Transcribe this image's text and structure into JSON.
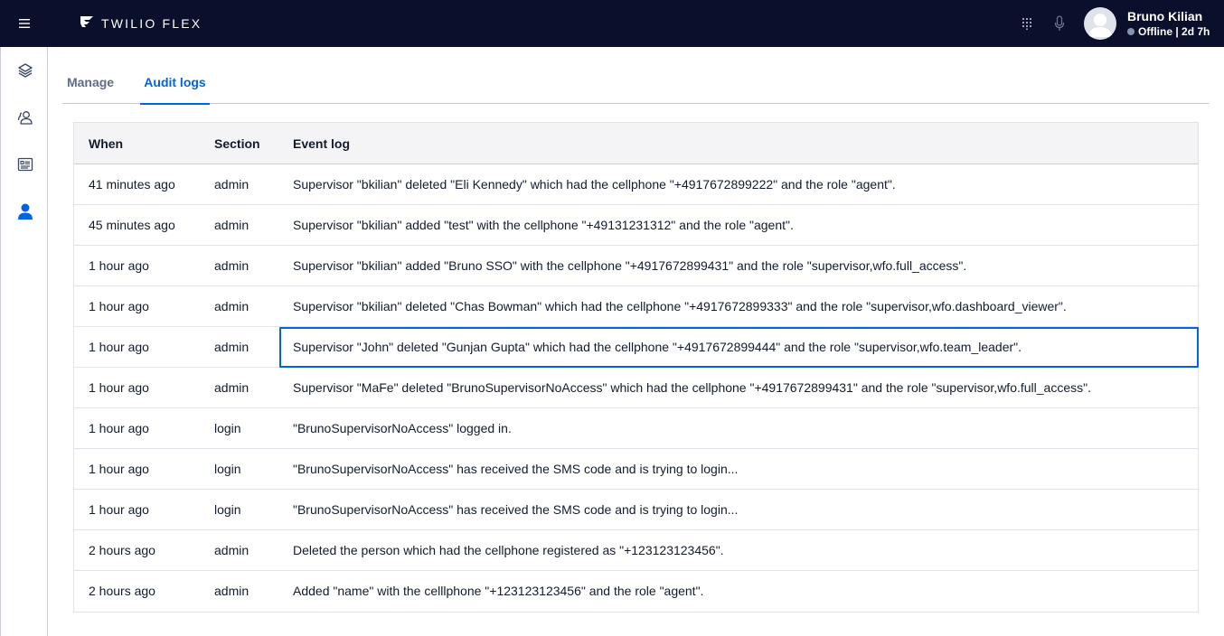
{
  "header": {
    "brand": "TWILIO FLEX",
    "user_name": "Bruno Kilian",
    "user_status": "Offline | 2d 7h"
  },
  "colors": {
    "topbar": "#0a0f2c",
    "accent": "#0263e0",
    "status_offline": "#8891aa"
  },
  "icons": {
    "menu": "hamburger-icon",
    "logo": "twilio-flex-logo",
    "dialpad": "dialpad-icon",
    "mic": "microphone-icon",
    "nav": [
      "layers-icon",
      "teams-icon",
      "contact-card-icon",
      "admin-user-icon"
    ]
  },
  "tabs": [
    {
      "label": "Manage",
      "active": false
    },
    {
      "label": "Audit logs",
      "active": true
    }
  ],
  "table": {
    "columns": [
      "When",
      "Section",
      "Event log"
    ],
    "rows": [
      {
        "when": "41 minutes ago",
        "section": "admin",
        "event": "Supervisor \"bkilian\" deleted \"Eli Kennedy\" which had the cellphone \"+4917672899222\" and the role \"agent\"."
      },
      {
        "when": "45 minutes ago",
        "section": "admin",
        "event": "Supervisor \"bkilian\" added \"test\" with the cellphone \"+49131231312\" and the role \"agent\"."
      },
      {
        "when": "1 hour ago",
        "section": "admin",
        "event": "Supervisor \"bkilian\" added \"Bruno SSO\" with the cellphone \"+4917672899431\" and the role \"supervisor,wfo.full_access\"."
      },
      {
        "when": "1 hour ago",
        "section": "admin",
        "event": "Supervisor \"bkilian\" deleted \"Chas Bowman\" which had the cellphone \"+4917672899333\" and the role \"supervisor,wfo.dashboard_viewer\"."
      },
      {
        "when": "1 hour ago",
        "section": "admin",
        "event": "Supervisor \"John\" deleted \"Gunjan Gupta\" which had the cellphone \"+4917672899444\" and the role \"supervisor,wfo.team_leader\"."
      },
      {
        "when": "1 hour ago",
        "section": "admin",
        "event": "Supervisor \"MaFe\" deleted \"BrunoSupervisorNoAccess\" which had the cellphone \"+4917672899431\" and the role \"supervisor,wfo.full_access\"."
      },
      {
        "when": "1 hour ago",
        "section": "login",
        "event": "\"BrunoSupervisorNoAccess\" logged in."
      },
      {
        "when": "1 hour ago",
        "section": "login",
        "event": "\"BrunoSupervisorNoAccess\" has received the SMS code and is trying to login..."
      },
      {
        "when": "1 hour ago",
        "section": "login",
        "event": "\"BrunoSupervisorNoAccess\" has received the SMS code and is trying to login..."
      },
      {
        "when": "2 hours ago",
        "section": "admin",
        "event": "Deleted the person which had the cellphone registered as \"+123123123456\"."
      },
      {
        "when": "2 hours ago",
        "section": "admin",
        "event": "Added \"name\" with the celllphone \"+123123123456\" and the role \"agent\"."
      }
    ]
  }
}
